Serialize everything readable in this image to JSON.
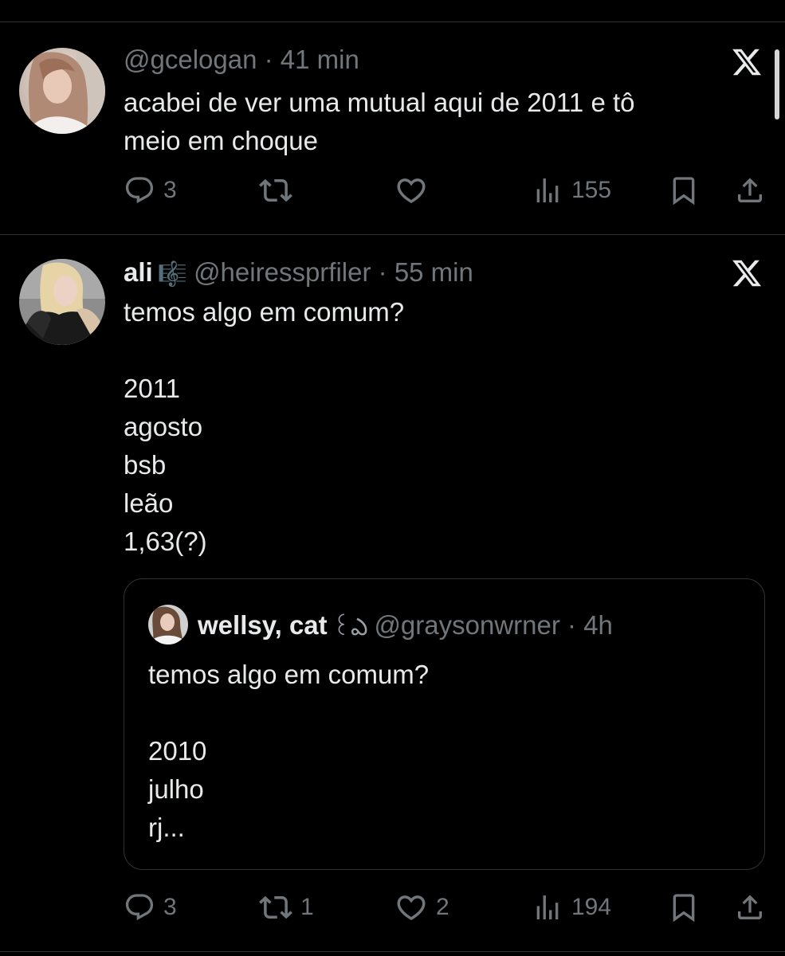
{
  "tweets": [
    {
      "handle": "@gcelogan",
      "separator": "·",
      "time": "41 min",
      "text": "acabei de ver uma mutual aqui de 2011 e tô\nmeio em choque",
      "replies": "3",
      "reposts": "",
      "likes": "",
      "views": "155"
    },
    {
      "display_name": "ali",
      "emoji": "🎼",
      "handle": "@heiressprfiler",
      "separator": "·",
      "time": "55 min",
      "text": "temos algo em comum?\n\n2011\nagosto\nbsb\nleão\n1,63(?)",
      "replies": "3",
      "reposts": "1",
      "likes": "2",
      "views": "194",
      "quote": {
        "display_name": "wellsy, cat",
        "emoji": "꒰ఎ",
        "handle": "@graysonwrner",
        "separator": "·",
        "time": "4h",
        "text": "temos algo em comum?\n\n2010\njulho\nrj..."
      }
    }
  ],
  "icons": {
    "reply": "reply-icon",
    "repost": "repost-icon",
    "like": "heart-icon",
    "views": "views-icon",
    "bookmark": "bookmark-icon",
    "share": "share-icon",
    "source": "x-logo-icon"
  },
  "colors": {
    "background": "#000000",
    "text": "#e7e9ea",
    "muted": "#71767b",
    "divider": "#2f3336"
  }
}
